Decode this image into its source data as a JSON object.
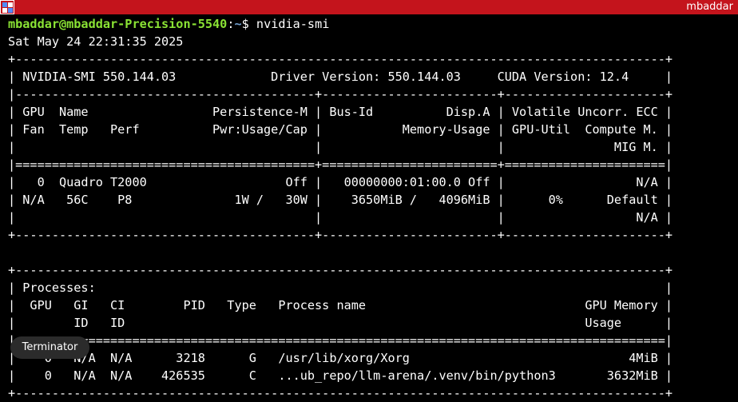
{
  "window": {
    "title": "mbaddar"
  },
  "prompt": {
    "user_host": "mbaddar@mbaddar-Precision-5540",
    "colon": ":",
    "path": "~",
    "symbol": "$ ",
    "command": "nvidia-smi"
  },
  "output_lines": [
    "Sat May 24 22:31:35 2025",
    "+-----------------------------------------------------------------------------------------+",
    "| NVIDIA-SMI 550.144.03             Driver Version: 550.144.03     CUDA Version: 12.4     |",
    "|-----------------------------------------+------------------------+----------------------+",
    "| GPU  Name                 Persistence-M | Bus-Id          Disp.A | Volatile Uncorr. ECC |",
    "| Fan  Temp   Perf          Pwr:Usage/Cap |           Memory-Usage | GPU-Util  Compute M. |",
    "|                                         |                        |               MIG M. |",
    "|=========================================+========================+======================|",
    "|   0  Quadro T2000                   Off |   00000000:01:00.0 Off |                  N/A |",
    "| N/A   56C    P8              1W /   30W |    3650MiB /   4096MiB |      0%      Default |",
    "|                                         |                        |                  N/A |",
    "+-----------------------------------------+------------------------+----------------------+",
    "",
    "+-----------------------------------------------------------------------------------------+",
    "| Processes:                                                                              |",
    "|  GPU   GI   CI        PID   Type   Process name                              GPU Memory |",
    "|        ID   ID                                                               Usage      |",
    "|=========================================================================================|",
    "|    0   N/A  N/A      3218      G   /usr/lib/xorg/Xorg                              4MiB |",
    "|    0   N/A  N/A    426535      C   ...ub_repo/llm-arena/.venv/bin/python3       3632MiB |",
    "+-----------------------------------------------------------------------------------------+"
  ],
  "tooltip": {
    "text": "Terminator"
  },
  "colors": {
    "titlebar": "#c4141c",
    "background": "#000000",
    "text": "#ffffff",
    "prompt_user": "#8ae234",
    "prompt_path": "#729fcf"
  }
}
